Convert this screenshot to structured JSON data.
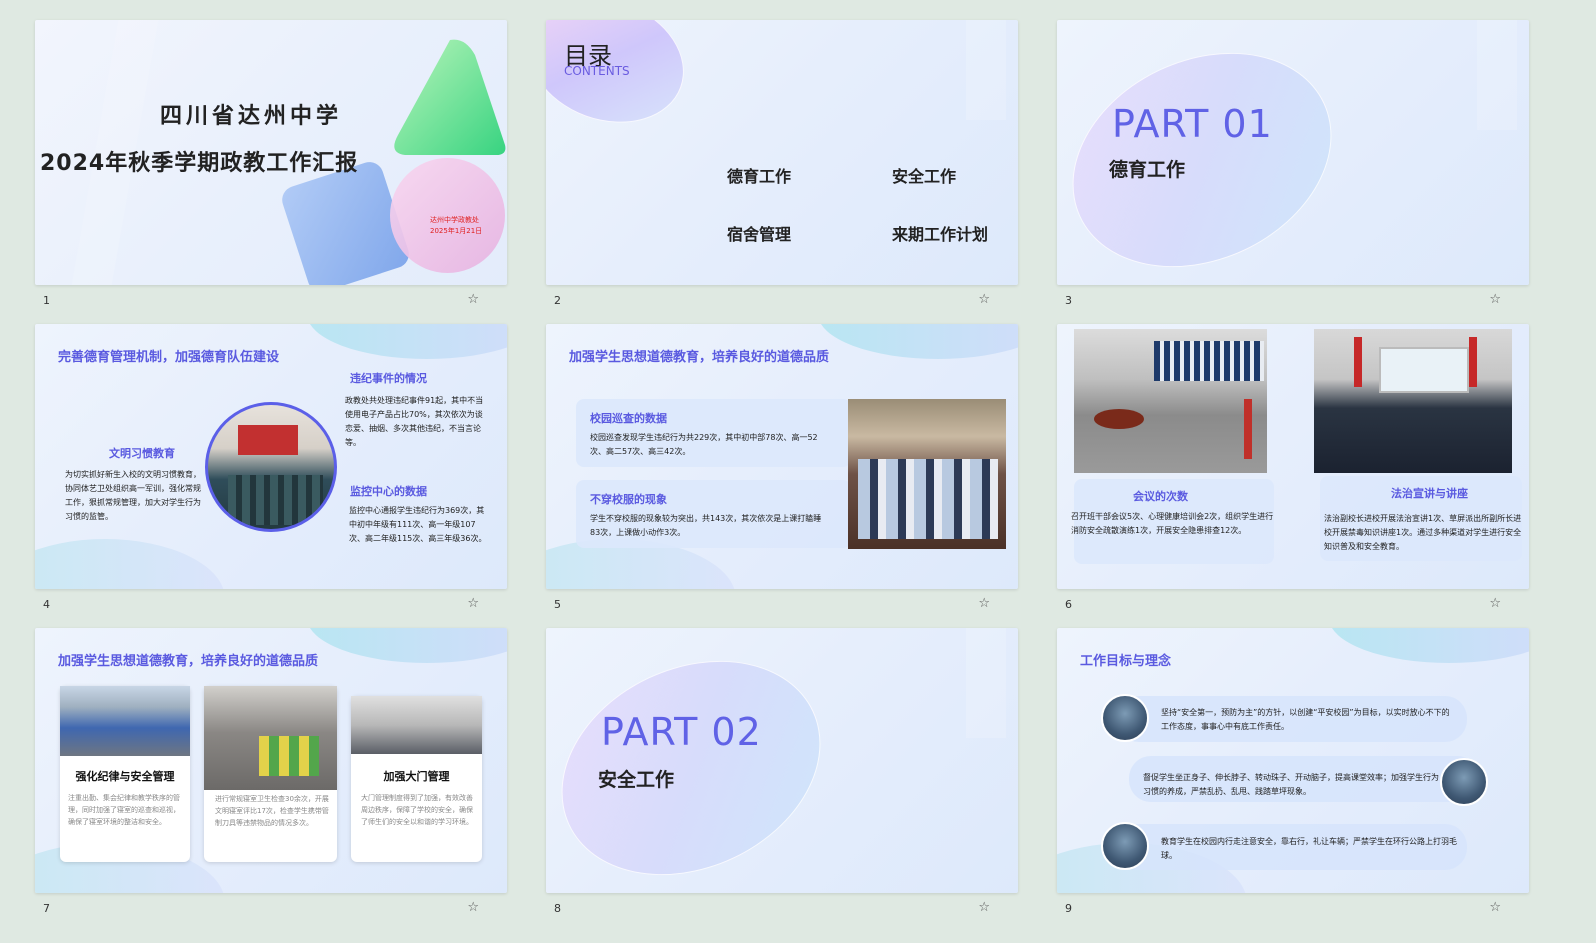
{
  "slides": [
    {
      "num": "1",
      "title_line1": "四川省达州中学",
      "title_line2": "2024年秋季学期政教工作汇报",
      "sub_line1": "达州中学政教处",
      "sub_line2": "2025年1月21日"
    },
    {
      "num": "2",
      "heading": "目录",
      "heading_en": "CONTENTS",
      "items": [
        "德育工作",
        "安全工作",
        "宿舍管理",
        "来期工作计划"
      ]
    },
    {
      "num": "3",
      "part": "PART 01",
      "part_title": "德育工作"
    },
    {
      "num": "4",
      "title": "完善德育管理机制，加强德育队伍建设",
      "left_title": "文明习惯教育",
      "left_text": "为切实抓好新生入校的文明习惯教育，协同体艺卫处组织高一军训，强化常规工作，狠抓常规管理，加大对学生行为习惯的监管。",
      "r1_title": "违纪事件的情况",
      "r1_text": "政教处共处理违纪事件91起，其中不当使用电子产品占比70%，其次依次为谈恋爱、抽烟、多次其他违纪，不当言论等。",
      "r2_title": "监控中心的数据",
      "r2_text": "监控中心通报学生违纪行为369次，其中初中年级有111次、高一年级107次、高二年级115次、高三年级36次。"
    },
    {
      "num": "5",
      "title": "加强学生思想道德教育，培养良好的道德品质",
      "b1_title": "校园巡查的数据",
      "b1_text": "校园巡查发现学生违纪行为共229次，其中初中部78次、高一52次、高二57次、高三42次。",
      "b2_title": "不穿校服的现象",
      "b2_text": "学生不穿校服的现象较为突出，共143次，其次依次是上课打瞌睡83次，上课做小动作3次。"
    },
    {
      "num": "6",
      "b1_title": "会议的次数",
      "b1_text": "召开班干部会议5次、心理健康培训会2次，组织学生进行消防安全疏散演练1次，开展安全隐患排查12次。",
      "b2_title": "法治宣讲与讲座",
      "b2_text": "法治副校长进校开展法治宣讲1次、草屏派出所副所长进校开展禁毒知识讲座1次。通过多种渠道对学生进行安全知识普及和安全教育。"
    },
    {
      "num": "7",
      "title": "加强学生思想道德教育，培养良好的道德品质",
      "c1_title": "强化纪律与安全管理",
      "c1_text": "注重出勤、集会纪律和教学秩序的管理，同时加强了寝室的巡查和巡视，确保了寝室环境的整洁和安全。",
      "c2_text": "进行常规寝室卫生检查30余次，开展文明寝室评比17次，检查学生携带管制刀具等违禁物品的情况多次。",
      "c3_title": "加强大门管理",
      "c3_text": "大门管理制度得到了加强，有效改善周边秩序，保障了学校的安全，确保了师生们的安全以和谐的学习环境。"
    },
    {
      "num": "8",
      "part": "PART 02",
      "part_title": "安全工作"
    },
    {
      "num": "9",
      "title": "工作目标与理念",
      "r1": "坚持“安全第一，预防为主”的方针，以创建“平安校园”为目标，以实时放心不下的工作态度，事事心中有底工作责任。",
      "r2": "督促学生坐正身子、伸长脖子、转动珠子、开动脑子，提高课堂效率；加强学生行为习惯的养成，严禁乱扔、乱甩、践踏草坪现象。",
      "r3": "教育学生在校园内行走注意安全，靠右行，礼让车辆；严禁学生在环行公路上打羽毛球。"
    }
  ],
  "star_icon": "☆",
  "colors": {
    "accent": "#5a5ae0",
    "background": "#dfe9e2"
  }
}
